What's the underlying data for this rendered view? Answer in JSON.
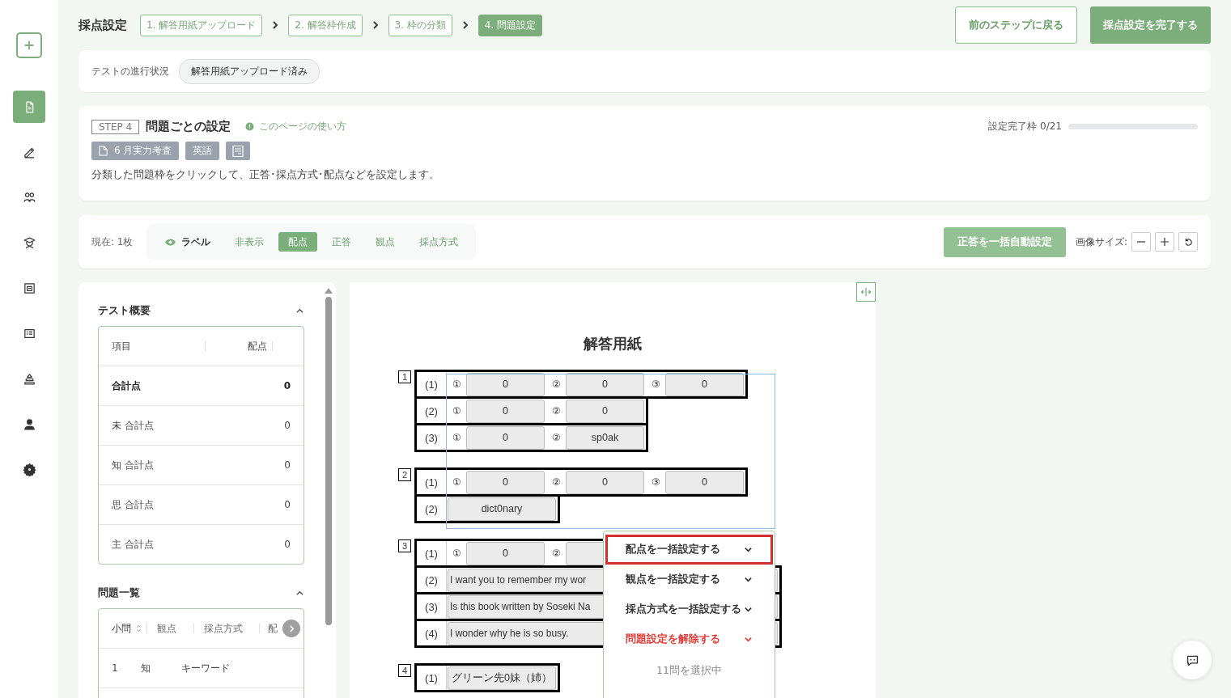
{
  "sidebar": {
    "items": [
      {
        "selected": true
      },
      {
        "selected": false
      },
      {
        "selected": false
      },
      {
        "selected": false
      },
      {
        "selected": false
      },
      {
        "selected": false
      },
      {
        "selected": false
      },
      {
        "selected": false
      },
      {
        "selected": false
      }
    ]
  },
  "header": {
    "title": "採点設定",
    "steps": [
      {
        "label": "1. 解答用紙アップロード",
        "selected": false
      },
      {
        "label": "2. 解答枠作成",
        "selected": false
      },
      {
        "label": "3. 枠の分類",
        "selected": false
      },
      {
        "label": "4. 問題設定",
        "selected": true
      }
    ],
    "buttons": [
      {
        "label": "前のステップに戻る",
        "kind": "secondary"
      },
      {
        "label": "採点設定を完了する",
        "kind": "primary"
      }
    ]
  },
  "status": {
    "label": "テストの進行状況",
    "chip": "解答用紙アップロード済み"
  },
  "step_card": {
    "step": "STEP 4",
    "title": "問題ごとの設定",
    "help_link": "このページの使い方",
    "tags": [
      {
        "label": "6 月実力考査",
        "kind": "document"
      },
      {
        "label": "英語",
        "kind": "plain"
      }
    ],
    "description": "分類した問題枠をクリックして、正答･採点方式･配点などを設定します。",
    "progress": {
      "label": "設定完了枠 0/21",
      "level": 0
    }
  },
  "toolbar": {
    "page_count": "現在: 1枚",
    "modes": [
      {
        "label": "ラベル",
        "kind": "toggle",
        "selected": false
      },
      {
        "label": "非表示",
        "kind": "mode",
        "selected": false
      },
      {
        "label": "配点",
        "kind": "mode",
        "selected": true
      },
      {
        "label": "正答",
        "kind": "mode",
        "selected": false
      },
      {
        "label": "観点",
        "kind": "mode",
        "selected": false
      },
      {
        "label": "採点方式",
        "kind": "mode",
        "selected": false
      }
    ],
    "auto_button": {
      "label": "正答を一括自動設定",
      "disabled": true
    },
    "size_label": "画像サイズ:"
  },
  "summary": {
    "title": "テスト概要",
    "expanded": true,
    "columns": [
      "項目",
      "配点"
    ],
    "rows": [
      {
        "label": "合計点",
        "value": "0",
        "kind": "total"
      },
      {
        "label": "未 合計点",
        "value": "0",
        "kind": "sub"
      },
      {
        "label": "知 合計点",
        "value": "0",
        "kind": "sub"
      },
      {
        "label": "思 合計点",
        "value": "0",
        "kind": "sub"
      },
      {
        "label": "主 合計点",
        "value": "0",
        "kind": "sub"
      }
    ]
  },
  "question_list": {
    "title": "問題一覧",
    "expanded": true,
    "columns": [
      {
        "label": "小問",
        "sortable": true
      },
      {
        "label": "観点",
        "sortable": false
      },
      {
        "label": "採点方式",
        "sortable": false
      },
      {
        "label": "配",
        "sortable": false
      }
    ],
    "rows": [
      {
        "cells": [
          "1",
          "知",
          "キーワード"
        ]
      }
    ]
  },
  "sheet": {
    "title": "解答用紙",
    "groups": [
      {
        "number": "1",
        "rows": [
          {
            "label": "(1)",
            "cells": [
              {
                "kind": "choice",
                "mark": "①",
                "text": "0"
              },
              {
                "kind": "choice",
                "mark": "②",
                "text": "0"
              },
              {
                "kind": "choice",
                "mark": "③",
                "text": "0"
              }
            ]
          },
          {
            "label": "(2)",
            "cells": [
              {
                "kind": "choice",
                "mark": "①",
                "text": "0"
              },
              {
                "kind": "choice",
                "mark": "②",
                "text": "0"
              }
            ]
          },
          {
            "label": "(3)",
            "cells": [
              {
                "kind": "choice",
                "mark": "①",
                "text": "0"
              },
              {
                "kind": "choice",
                "mark": "②",
                "text": "sp0ak"
              }
            ]
          }
        ]
      },
      {
        "number": "2",
        "rows": [
          {
            "label": "(1)",
            "cells": [
              {
                "kind": "choice",
                "mark": "①",
                "text": "0"
              },
              {
                "kind": "choice",
                "mark": "②",
                "text": "0"
              },
              {
                "kind": "choice",
                "mark": "③",
                "text": "0"
              }
            ]
          },
          {
            "label": "(2)",
            "cells": [
              {
                "kind": "text",
                "text": "dict0nary"
              }
            ]
          }
        ]
      },
      {
        "number": "3",
        "rows": [
          {
            "label": "(1)",
            "cells": [
              {
                "kind": "choice",
                "mark": "①",
                "text": "0"
              },
              {
                "kind": "choice",
                "mark": "②"
              }
            ]
          },
          {
            "label": "(2)",
            "cells": [
              {
                "kind": "sentence",
                "text": "I want you to remember my wor"
              }
            ]
          },
          {
            "label": "(3)",
            "cells": [
              {
                "kind": "sentence",
                "text": "Is this book written by Soseki Na"
              }
            ]
          },
          {
            "label": "(4)",
            "cells": [
              {
                "kind": "sentence",
                "text": "I wonder why he is so busy."
              }
            ]
          }
        ]
      },
      {
        "number": "4",
        "rows": [
          {
            "label": "(1)",
            "cells": [
              {
                "kind": "text",
                "text": "グリーン先0妹（姉）"
              }
            ]
          }
        ]
      }
    ]
  },
  "menu": {
    "items": [
      {
        "label": "配点を一括設定する",
        "kind": "normal",
        "selected": true
      },
      {
        "label": "観点を一括設定する",
        "kind": "normal",
        "selected": false
      },
      {
        "label": "採点方式を一括設定する",
        "kind": "normal",
        "selected": false
      },
      {
        "label": "問題設定を解除する",
        "kind": "danger",
        "selected": false
      }
    ],
    "footer": "11問を選択中"
  }
}
